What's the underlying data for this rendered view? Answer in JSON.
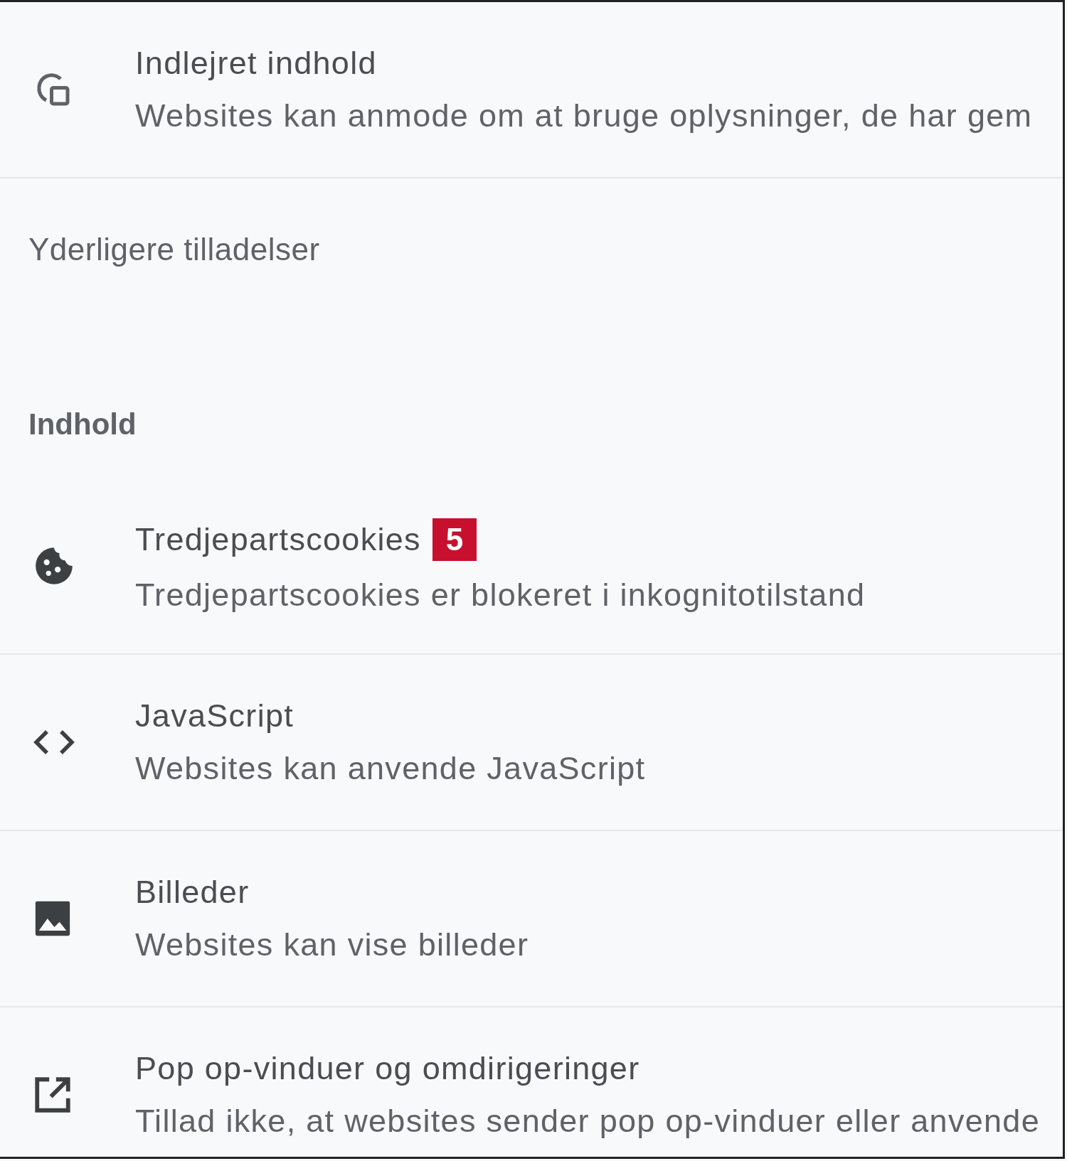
{
  "top_rows": [
    {
      "kind": "embedded",
      "title": "Indlejret indhold",
      "description": "Websites kan anmode om at bruge oplysninger, de har gem"
    }
  ],
  "additional_permissions": {
    "label": "Yderligere tilladelser"
  },
  "content_section": {
    "heading": "Indhold",
    "rows": [
      {
        "kind": "cookie",
        "title": "Tredjepartscookies",
        "badge": "5",
        "description": "Tredjepartscookies er blokeret i inkognitotilstand"
      },
      {
        "kind": "code",
        "title": "JavaScript",
        "description": "Websites kan anvende JavaScript"
      },
      {
        "kind": "image",
        "title": "Billeder",
        "description": "Websites kan vise billeder"
      },
      {
        "kind": "popup",
        "title": "Pop op-vinduer og omdirigeringer",
        "description": "Tillad ikke, at websites sender pop op-vinduer eller anvende"
      }
    ]
  }
}
